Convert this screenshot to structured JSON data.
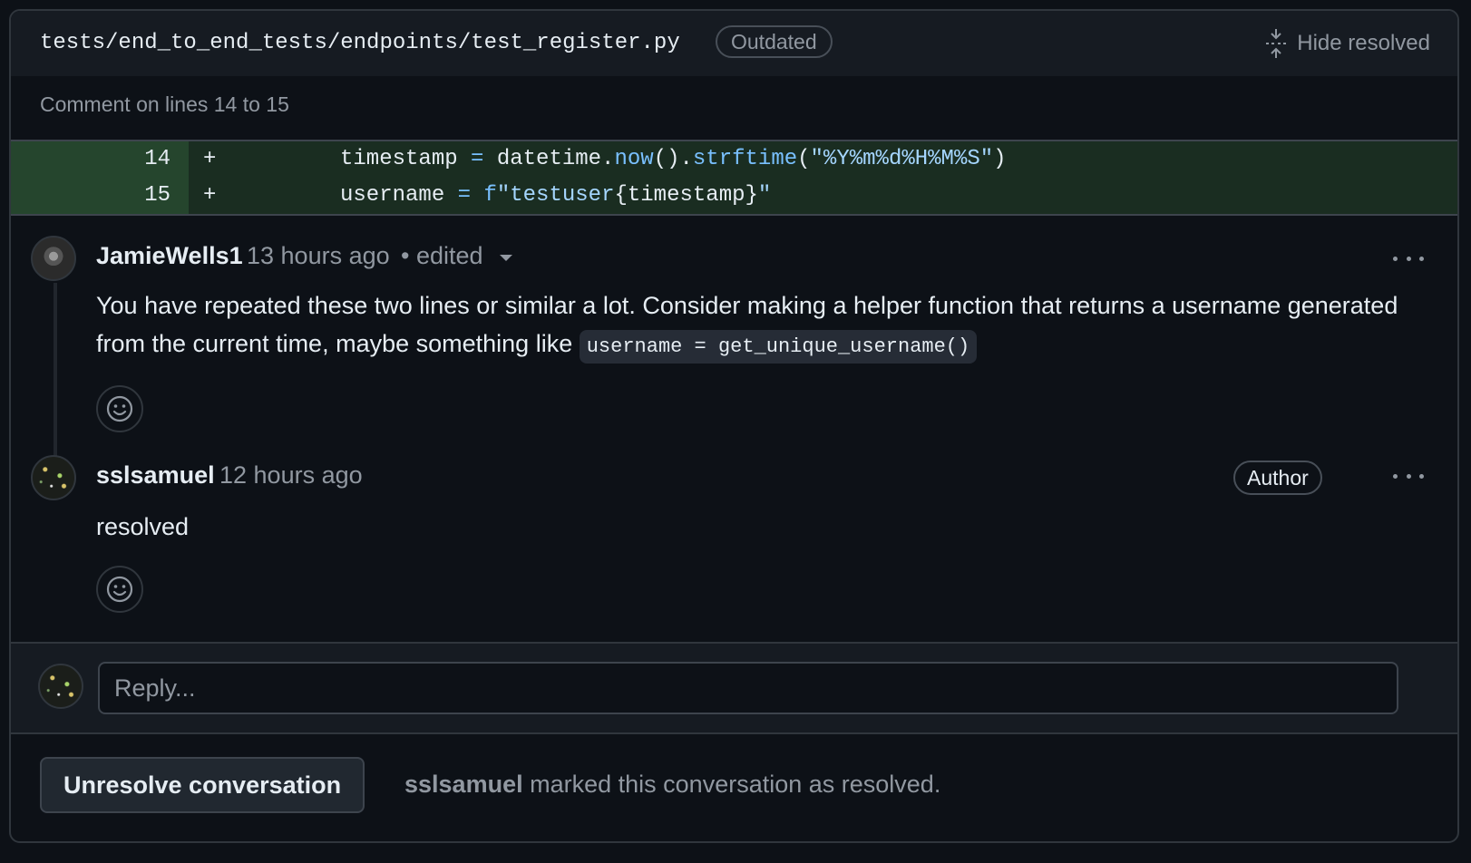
{
  "header": {
    "file_path": "tests/end_to_end_tests/endpoints/test_register.py",
    "badge": "Outdated",
    "hide_resolved": "Hide resolved"
  },
  "comment_on": "Comment on lines 14 to 15",
  "diff": [
    {
      "line": "14",
      "marker": "+",
      "code": "timestamp = datetime.now().strftime(\"%Y%m%d%H%M%S\")"
    },
    {
      "line": "15",
      "marker": "+",
      "code": "username = f\"testuser{timestamp}\""
    }
  ],
  "comments": [
    {
      "author": "JamieWells1",
      "time": "13 hours ago",
      "edited": "• edited",
      "body": "You have repeated these two lines or similar a lot. Consider making a helper function that returns a username generated from the current time, maybe something like",
      "inline_code": "username = get_unique_username()"
    },
    {
      "author": "sslsamuel",
      "time": "12 hours ago",
      "badge": "Author",
      "body": "resolved"
    }
  ],
  "reply": {
    "placeholder": "Reply..."
  },
  "footer": {
    "button": "Unresolve conversation",
    "resolver": "sslsamuel",
    "resolved_text": "marked this conversation as resolved."
  },
  "colors": {
    "background": "#0d1117",
    "diff_added_bg": "#1a2d21",
    "diff_line_number_bg": "#25452d",
    "muted_text": "#9198a1",
    "syntax_blue": "#79c0ff"
  }
}
